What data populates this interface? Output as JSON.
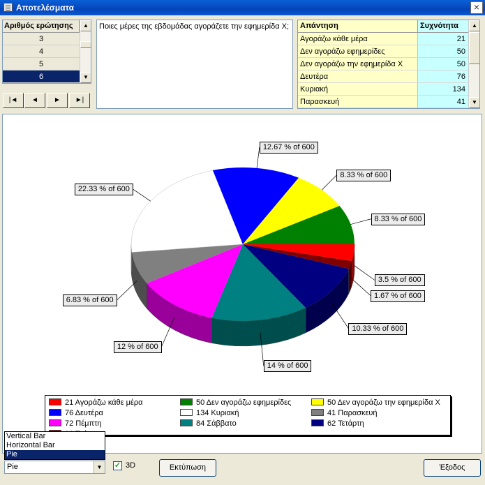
{
  "window": {
    "title": "Αποτελέσματα",
    "close_label": "×"
  },
  "question_grid": {
    "header": "Αριθμός ερώτησης",
    "rows": [
      "3",
      "4",
      "5",
      "6"
    ],
    "selected_index": 3
  },
  "nav": {
    "first": "|◄",
    "prev": "◄",
    "next": "►",
    "last": "►|"
  },
  "question_text": "Ποιες μέρες της εβδομάδας αγοράζετε την εφημερίδα Χ;",
  "answers_grid": {
    "headers": [
      "Απάντηση",
      "Συχνότητα"
    ],
    "rows": [
      {
        "answer": "Αγοράζω κάθε μέρα",
        "freq": "21"
      },
      {
        "answer": "Δεν αγοράζω εφημερίδες",
        "freq": "50"
      },
      {
        "answer": "Δεν αγοράζω την εφημερίδα Χ",
        "freq": "50"
      },
      {
        "answer": "Δευτέρα",
        "freq": "76"
      },
      {
        "answer": "Κυριακή",
        "freq": "134"
      },
      {
        "answer": "Παρασκευή",
        "freq": "41"
      }
    ]
  },
  "chart_data": {
    "type": "pie",
    "three_d": true,
    "total": 600,
    "slices": [
      {
        "name": "Αγοράζω κάθε μέρα",
        "value": 21,
        "label": "3.5 % of 600",
        "color": "#ff0000"
      },
      {
        "name": "Τρίτη",
        "value": 10,
        "label": "1.67 % of 600",
        "color": "#800000"
      },
      {
        "name": "Τετάρτη",
        "value": 62,
        "label": "10.33 % of 600",
        "color": "#000080"
      },
      {
        "name": "Σάββατο",
        "value": 84,
        "label": "14 % of 600",
        "color": "#008080"
      },
      {
        "name": "Πέμπτη",
        "value": 72,
        "label": "12 % of 600",
        "color": "#ff00ff"
      },
      {
        "name": "Παρασκευή",
        "value": 41,
        "label": "6.83 % of 600",
        "color": "#808080"
      },
      {
        "name": "Κυριακή",
        "value": 134,
        "label": "22.33 % of 600",
        "color": "#ffffff"
      },
      {
        "name": "Δευτέρα",
        "value": 76,
        "label": "12.67 % of 600",
        "color": "#0000ff"
      },
      {
        "name": "Δεν αγοράζω την εφημερίδα Χ",
        "value": 50,
        "label": "8.33 % of 600",
        "color": "#ffff00"
      },
      {
        "name": "Δεν αγοράζω εφημερίδες",
        "value": 50,
        "label": "8.33 % of 600",
        "color": "#008000"
      }
    ],
    "legend": [
      {
        "text": "21 Αγοράζω κάθε μέρα",
        "color": "#ff0000"
      },
      {
        "text": "50 Δεν αγοράζω εφημερίδες",
        "color": "#008000"
      },
      {
        "text": "50 Δεν αγοράζω την εφημερίδα Χ",
        "color": "#ffff00"
      },
      {
        "text": "76 Δευτέρα",
        "color": "#0000ff"
      },
      {
        "text": "134 Κυριακή",
        "color": "#ffffff"
      },
      {
        "text": "41 Παρασκευή",
        "color": "#808080"
      },
      {
        "text": "72 Πέμπτη",
        "color": "#ff00ff"
      },
      {
        "text": "84 Σάββατο",
        "color": "#008080"
      },
      {
        "text": "62 Τετάρτη",
        "color": "#000080"
      },
      {
        "text": "10 Τρίτη",
        "color": "#800000"
      }
    ]
  },
  "chart_type_dropdown": {
    "options": [
      "Vertical Bar",
      "Horizontal Bar",
      "Pie"
    ],
    "selected": "Pie"
  },
  "controls": {
    "three_d_label": "3D",
    "three_d_checked": "✓",
    "print_label": "Εκτύπωση",
    "exit_label": "Έξοδος"
  }
}
